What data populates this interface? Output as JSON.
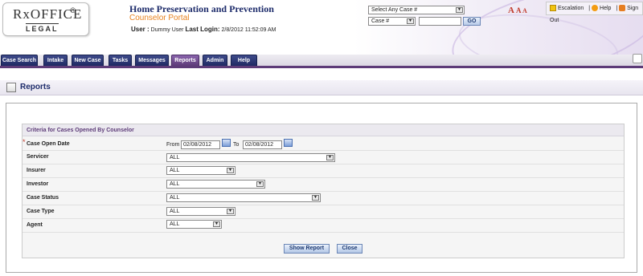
{
  "header": {
    "logo_top": "RxOFFICE",
    "logo_reg": "®",
    "logo_bottom": "LEGAL",
    "app_title": "Home Preservation and Prevention",
    "app_subtitle": "Counselor Portal",
    "user_label": "User :",
    "user_name": "Dummy User",
    "last_login_label": "Last Login:",
    "last_login_value": "2/8/2012 11:52:09 AM",
    "case_select": "Select Any Case #",
    "case_type_select": "Case #",
    "case_search_value": "",
    "go_label": "GO",
    "font_size_a1": "A",
    "font_size_a2": "A",
    "font_size_a3": "A",
    "escalation": "Escalation",
    "help": "Help",
    "sign_out": "Sign Out"
  },
  "nav": {
    "tabs": [
      "Case Search",
      "Intake",
      "New Case",
      "Tasks",
      "Messages",
      "Reports",
      "Admin",
      "Help"
    ],
    "active": "Reports"
  },
  "page": {
    "title": "Reports"
  },
  "criteria": {
    "title": "Criteria for Cases Opened By Counselor",
    "case_open_date_label": "Case Open Date",
    "required_mark": "*",
    "from_label": "From",
    "from_value": "02/08/2012",
    "to_label": "To",
    "to_value": "02/08/2012",
    "servicer_label": "Servicer",
    "servicer_value": "ALL",
    "insurer_label": "Insurer",
    "insurer_value": "ALL",
    "investor_label": "Investor",
    "investor_value": "ALL",
    "case_status_label": "Case Status",
    "case_status_value": "ALL",
    "case_type_label": "Case Type",
    "case_type_value": "ALL",
    "agent_label": "Agent",
    "agent_value": "ALL",
    "show_report": "Show Report",
    "close": "Close"
  },
  "colors": {
    "accent": "#5d3b78",
    "title": "#1e2c6b",
    "subtitle": "#e8821e",
    "tab": "#1f2a63"
  }
}
